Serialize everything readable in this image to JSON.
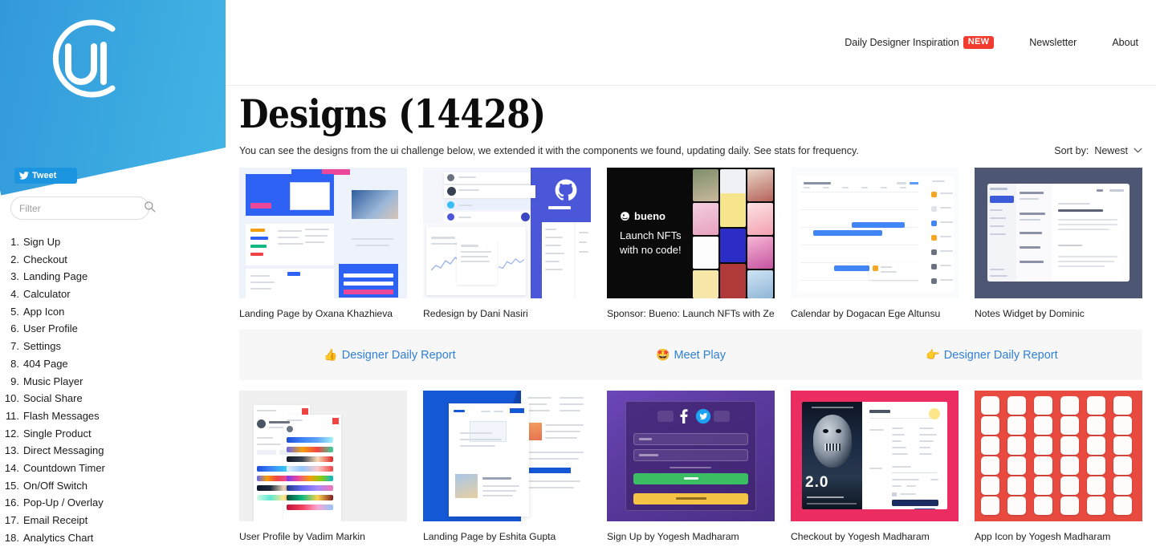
{
  "sidebar": {
    "logo_alt": "ui logo",
    "tweet_label": "Tweet",
    "filter_placeholder": "Filter",
    "filter_value": "",
    "items": [
      {
        "num": "1.",
        "label": "Sign Up"
      },
      {
        "num": "2.",
        "label": "Checkout"
      },
      {
        "num": "3.",
        "label": "Landing Page"
      },
      {
        "num": "4.",
        "label": "Calculator"
      },
      {
        "num": "5.",
        "label": "App Icon"
      },
      {
        "num": "6.",
        "label": "User Profile"
      },
      {
        "num": "7.",
        "label": "Settings"
      },
      {
        "num": "8.",
        "label": "404 Page"
      },
      {
        "num": "9.",
        "label": "Music Player"
      },
      {
        "num": "10.",
        "label": "Social Share"
      },
      {
        "num": "11.",
        "label": "Flash Messages"
      },
      {
        "num": "12.",
        "label": "Single Product"
      },
      {
        "num": "13.",
        "label": "Direct Messaging"
      },
      {
        "num": "14.",
        "label": "Countdown Timer"
      },
      {
        "num": "15.",
        "label": "On/Off Switch"
      },
      {
        "num": "16.",
        "label": "Pop-Up / Overlay"
      },
      {
        "num": "17.",
        "label": "Email Receipt"
      },
      {
        "num": "18.",
        "label": "Analytics Chart"
      }
    ]
  },
  "topnav": {
    "daily_label": "Daily Designer Inspiration",
    "new_badge": "NEW",
    "newsletter_label": "Newsletter",
    "about_label": "About"
  },
  "main": {
    "title": "Designs (14428)",
    "subtitle_before": "You can see the designs from the ui challenge below, we extended it with the components we found, updating daily. See ",
    "subtitle_link": "stats",
    "subtitle_after": " for frequency.",
    "sort_label": "Sort by:",
    "sort_value": "Newest",
    "sort_chevron": "⌄"
  },
  "promo": [
    {
      "emoji": "👍",
      "label": "Designer Daily Report"
    },
    {
      "emoji": "🤩",
      "label": "Meet Play"
    },
    {
      "emoji": "👉",
      "label": "Designer Daily Report"
    }
  ],
  "designs_row1": [
    {
      "caption": "Landing Page by Oxana Khazhieva"
    },
    {
      "caption": "Redesign by Dani Nasiri"
    },
    {
      "caption": "Sponsor: Bueno: Launch NFTs with Ze"
    },
    {
      "caption": "Calendar by Dogacan Ege Altunsu"
    },
    {
      "caption": "Notes Widget by Dominic"
    }
  ],
  "designs_row2": [
    {
      "caption": "User Profile by Vadim Markin"
    },
    {
      "caption": "Landing Page by Eshita Gupta"
    },
    {
      "caption": "Sign Up by Yogesh Madharam"
    },
    {
      "caption": "Checkout by Yogesh Madharam"
    },
    {
      "caption": "App Icon by Yogesh Madharam"
    }
  ],
  "thumb_text": {
    "bueno_brand": "bueno",
    "bueno_line1": "Launch NFTs",
    "bueno_line2": "with no code!",
    "movie_title": "2.0"
  },
  "colors": {
    "logo_blue": "#3aa8e0",
    "badge_red": "#f23a2e",
    "link_blue": "#2f7fd6",
    "tweet_blue": "#1b95e0",
    "promo_bg": "#f7f7f7"
  }
}
